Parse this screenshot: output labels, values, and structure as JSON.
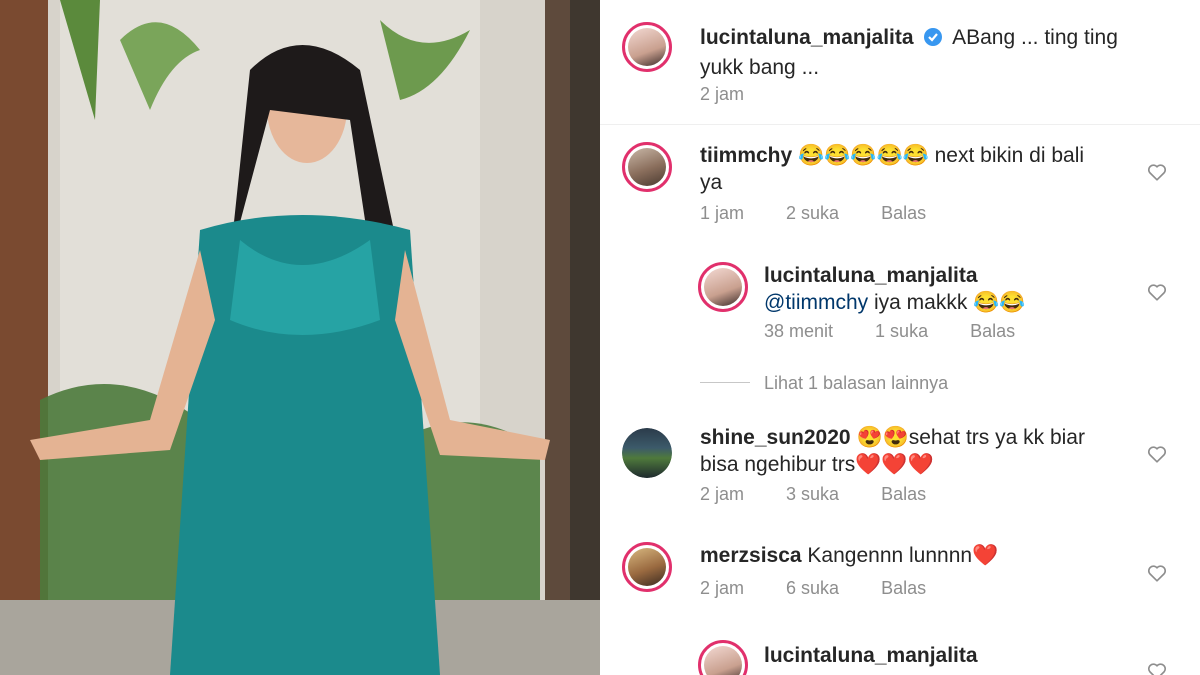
{
  "caption": {
    "username": "lucintaluna_manjalita",
    "text_line1": "ABang ... ting ting",
    "text_line2": "yukk bang ...",
    "time": "2 jam"
  },
  "comments": [
    {
      "username": "tiimmchy",
      "text_line1": "😂😂😂😂😂 next bikin di bali",
      "text_line2": "ya",
      "time": "1 jam",
      "likes": "2 suka",
      "reply": "Balas"
    },
    {
      "username": "lucintaluna_manjalita",
      "mention": "@tiimmchy",
      "text": "iya makkk 😂😂",
      "time": "38 menit",
      "likes": "1 suka",
      "reply": "Balas"
    },
    {
      "username": "shine_sun2020",
      "text_line1": "😍😍sehat trs ya kk biar",
      "text_line2": "bisa ngehibur trs❤️❤️❤️",
      "time": "2 jam",
      "likes": "3 suka",
      "reply": "Balas"
    },
    {
      "username": "merzsisca",
      "text": "Kangennn lunnnn❤️",
      "time": "2 jam",
      "likes": "6 suka",
      "reply": "Balas"
    },
    {
      "username": "lucintaluna_manjalita"
    }
  ],
  "view_replies": "Lihat 1 balasan lainnya",
  "colors": {
    "ring": "#e1306c",
    "verified": "#3897f0",
    "mention": "#00376b",
    "muted": "#8e8e8e"
  },
  "icons": [
    "verified-badge-icon",
    "heart-icon"
  ]
}
